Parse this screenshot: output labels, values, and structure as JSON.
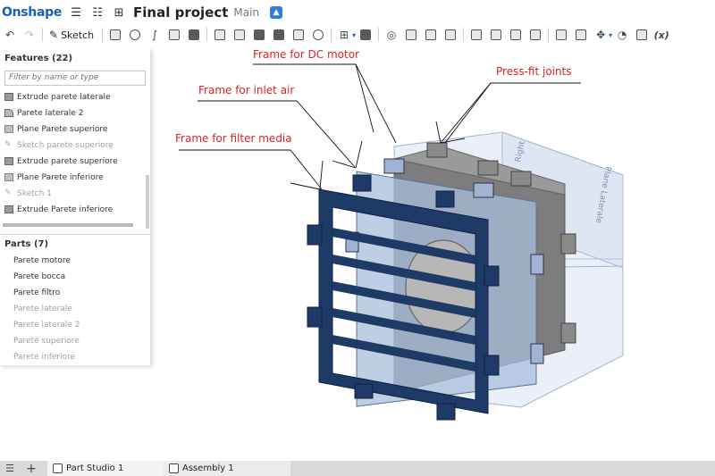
{
  "app": {
    "logo": "Onshape",
    "title": "Final project",
    "branch": "Main"
  },
  "toolbar": {
    "sketch_label": "Sketch",
    "fx_label": "(x)"
  },
  "features": {
    "header": "Features (22)",
    "filter_placeholder": "Filter by name or type",
    "items": [
      {
        "label": "Extrude parete laterale",
        "icon": "extrude-icon"
      },
      {
        "label": "Parete laterale 2",
        "icon": "shell-icon"
      },
      {
        "label": "Plane Parete superiore",
        "icon": "plane-icon"
      },
      {
        "label": "Sketch parete superiore",
        "icon": "sketch-icon"
      },
      {
        "label": "Extrude parete superiore",
        "icon": "extrude-icon"
      },
      {
        "label": "Plane Parete inferiore",
        "icon": "plane-icon"
      },
      {
        "label": "Sketch 1",
        "icon": "sketch-icon"
      },
      {
        "label": "Extrude Parete inferiore",
        "icon": "extrude-icon"
      }
    ]
  },
  "parts": {
    "header": "Parts (7)",
    "items": [
      {
        "label": "Parete motore"
      },
      {
        "label": "Parete bocca"
      },
      {
        "label": "Parete filtro"
      },
      {
        "label": "Parete laterale"
      },
      {
        "label": "Parete laterale 2"
      },
      {
        "label": "Parete superiore"
      },
      {
        "label": "Parete inferiore"
      }
    ]
  },
  "annotations": {
    "dc_motor": "Frame for DC motor",
    "press_fit": "Press-fit joints",
    "inlet_air": "Frame for inlet air",
    "filter_media": "Frame for filter media"
  },
  "viewport": {
    "plane_right": "Right",
    "plane_laterale": "Plane Laterale"
  },
  "tabs": {
    "part_studio": "Part Studio 1",
    "assembly": "Assembly 1"
  },
  "colors": {
    "brand": "#1a5fb4",
    "annotation": "#d9241d",
    "frame_dark": "#1d3a66",
    "panel_gray": "#8b8b8b"
  }
}
